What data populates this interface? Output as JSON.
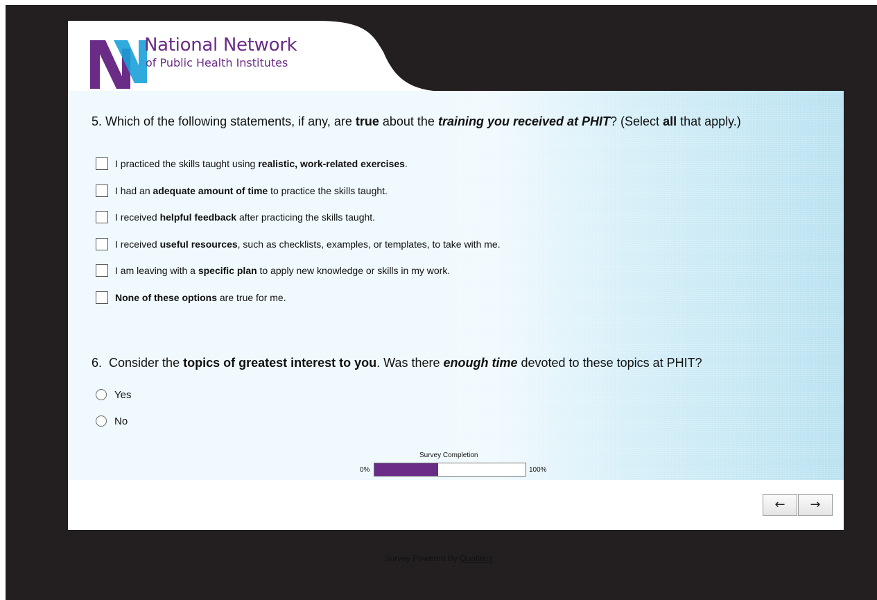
{
  "brand": {
    "line1": "National Network",
    "line2": "of Public Health Institutes",
    "purple": "#6a2c87",
    "blue": "#1aa0d8"
  },
  "q5": {
    "number": "5.",
    "text_1": " Which of the following statements, if any, are ",
    "bold_1": "true",
    "text_2": " about the ",
    "bold_italic_1": "training you received at PHIT",
    "text_3": "? (Select ",
    "bold_2": "all",
    "text_4": " that apply.)",
    "options": [
      {
        "pre": "I practiced the skills taught using ",
        "bold": "realistic, work-related exercises",
        "post": ".",
        "checked": false
      },
      {
        "pre": "I had an ",
        "bold": "adequate amount of time",
        "post": " to practice the skills taught.",
        "checked": false
      },
      {
        "pre": "I received ",
        "bold": "helpful feedback",
        "post": " after practicing the skills taught.",
        "checked": false
      },
      {
        "pre": "I received ",
        "bold": "useful resources",
        "post": ", such as checklists, examples, or templates, to take with me.",
        "checked": false
      },
      {
        "pre": "I am leaving with a ",
        "bold": "specific plan",
        "post": " to apply new knowledge or skills in my work.",
        "checked": false
      },
      {
        "pre": "",
        "bold": "None of these options",
        "post": " are true for me.",
        "checked": false
      }
    ]
  },
  "q6": {
    "number": "6.",
    "text_1": "  Consider the ",
    "bold_1": "topics of greatest interest to you",
    "text_2": ". Was there ",
    "bold_italic_1": "enough time",
    "text_3": " devoted to these topics at PHIT?",
    "options": [
      {
        "label": "Yes",
        "selected": false
      },
      {
        "label": "No",
        "selected": false
      }
    ]
  },
  "progress": {
    "title": "Survey Completion",
    "min_label": "0%",
    "max_label": "100%",
    "fraction": 0.42
  },
  "nav": {
    "back": "←",
    "next": "→"
  },
  "credit": {
    "prefix": "Survey Powered By ",
    "link": "Qualtrics"
  }
}
